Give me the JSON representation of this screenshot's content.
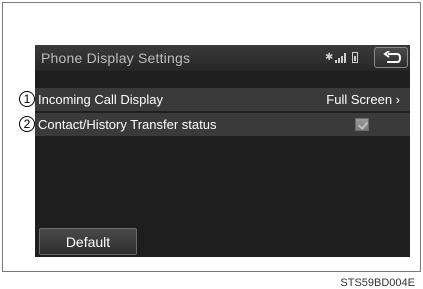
{
  "header": {
    "title": "Phone Display Settings",
    "bluetooth_icon": "✱",
    "back_icon": "back-arrow-icon"
  },
  "rows": [
    {
      "label": "Incoming Call Display",
      "value": "Full Screen ›"
    },
    {
      "label": "Contact/History Transfer status",
      "checked": true
    }
  ],
  "default_button": "Default",
  "callouts": [
    "1",
    "2"
  ],
  "caption": "STS59BD004E"
}
